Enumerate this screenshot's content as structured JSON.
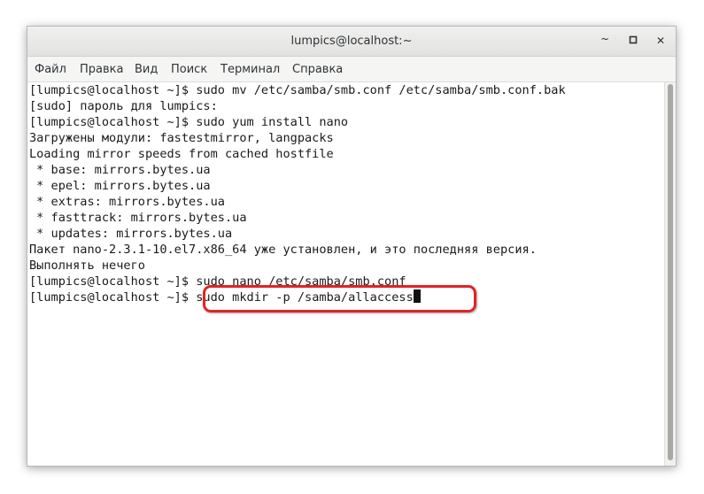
{
  "window": {
    "title": "lumpics@localhost:~",
    "minimize_glyph": "~",
    "maximize_glyph": "▫",
    "close_glyph": "✕"
  },
  "menu": [
    "Файл",
    "Правка",
    "Вид",
    "Поиск",
    "Терминал",
    "Справка"
  ],
  "terminal": {
    "lines": [
      "[lumpics@localhost ~]$ sudo mv /etc/samba/smb.conf /etc/samba/smb.conf.bak",
      "[sudo] пароль для lumpics:",
      "[lumpics@localhost ~]$ sudo yum install nano",
      "Загружены модули: fastestmirror, langpacks",
      "Loading mirror speeds from cached hostfile",
      " * base: mirrors.bytes.ua",
      " * epel: mirrors.bytes.ua",
      " * extras: mirrors.bytes.ua",
      " * fasttrack: mirrors.bytes.ua",
      " * updates: mirrors.bytes.ua",
      "Пакет nano-2.3.1-10.el7.x86_64 уже установлен, и это последняя версия.",
      "Выполнять нечего",
      "[lumpics@localhost ~]$ sudo nano /etc/samba/smb.conf"
    ],
    "current_prompt": "[lumpics@localhost ~]$ ",
    "current_command": "sudo mkdir -p /samba/allaccess"
  },
  "colors": {
    "highlight": "#e02424"
  }
}
